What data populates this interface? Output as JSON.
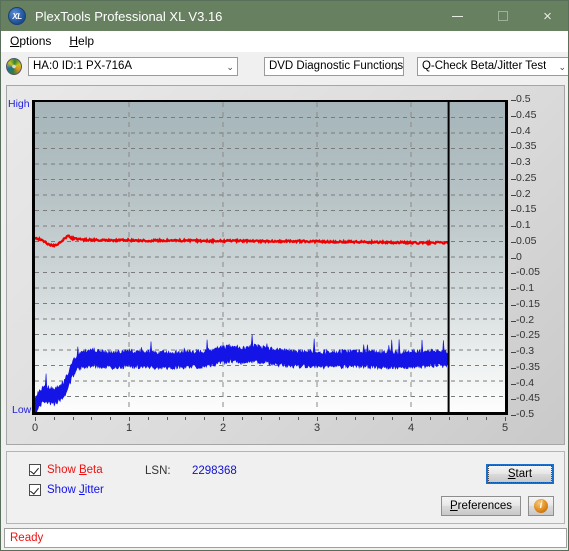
{
  "window": {
    "title": "PlexTools Professional XL V3.16",
    "icon": "XL",
    "minimize_label": "—",
    "maximize_label": "□",
    "close_label": "×",
    "titlebar_color": "#67805f"
  },
  "menu": {
    "items": [
      {
        "label": "Options",
        "accel": "O"
      },
      {
        "label": "Help",
        "accel": "H"
      }
    ]
  },
  "toolbar": {
    "drive_select": {
      "value": "HA:0 ID:1  PX-716A",
      "arrow": "⌄"
    },
    "function_select": {
      "value": "DVD Diagnostic Functions",
      "arrow": "⌄"
    },
    "test_select": {
      "value": "Q-Check Beta/Jitter Test",
      "arrow": "⌄"
    }
  },
  "chart_data": {
    "type": "line",
    "title": "",
    "xlabel": "",
    "ylabel": "",
    "xlim": [
      0,
      5
    ],
    "ylim": [
      -0.5,
      0.5
    ],
    "xticks": [
      0,
      1,
      2,
      3,
      4,
      5
    ],
    "xtick_labels": [
      "0",
      "1",
      "2",
      "3",
      "4",
      "5"
    ],
    "yticks": [
      0.5,
      0.45,
      0.4,
      0.35,
      0.3,
      0.25,
      0.2,
      0.15,
      0.1,
      0.05,
      0,
      -0.05,
      -0.1,
      -0.15,
      -0.2,
      -0.25,
      -0.3,
      -0.35,
      -0.4,
      -0.45,
      -0.5
    ],
    "ytick_labels": [
      "0.5",
      "0.45",
      "0.4",
      "0.35",
      "0.3",
      "0.25",
      "0.2",
      "0.15",
      "0.1",
      "0.05",
      "0",
      "-0.05",
      "-0.1",
      "-0.15",
      "-0.2",
      "-0.25",
      "-0.3",
      "-0.35",
      "-0.4",
      "-0.45",
      "-0.5"
    ],
    "axis_high_label": "High",
    "axis_low_label": "Low",
    "grid": true,
    "grid_style": "dashed",
    "data_end_x": 4.4,
    "marker_line_x": 4.4,
    "series": [
      {
        "name": "Beta",
        "color": "#ee0000",
        "x": [
          0.0,
          0.05,
          0.1,
          0.15,
          0.2,
          0.25,
          0.3,
          0.35,
          0.4,
          0.5,
          0.6,
          0.7,
          0.8,
          0.9,
          1.0,
          1.2,
          1.4,
          1.6,
          1.8,
          2.0,
          2.2,
          2.4,
          2.6,
          2.8,
          3.0,
          3.2,
          3.4,
          3.6,
          3.8,
          4.0,
          4.1,
          4.2,
          4.3,
          4.4
        ],
        "values": [
          0.06,
          0.058,
          0.05,
          0.04,
          0.036,
          0.042,
          0.056,
          0.068,
          0.06,
          0.056,
          0.055,
          0.055,
          0.054,
          0.054,
          0.054,
          0.053,
          0.053,
          0.053,
          0.052,
          0.052,
          0.052,
          0.051,
          0.051,
          0.051,
          0.05,
          0.049,
          0.049,
          0.048,
          0.047,
          0.046,
          0.045,
          0.046,
          0.046,
          0.046
        ],
        "noise": 0.006
      },
      {
        "name": "Jitter",
        "color": "#1414e6",
        "x": [
          0.0,
          0.05,
          0.1,
          0.15,
          0.2,
          0.25,
          0.3,
          0.35,
          0.4,
          0.45,
          0.5,
          0.6,
          0.7,
          0.8,
          0.9,
          1.0,
          1.2,
          1.4,
          1.6,
          1.8,
          2.0,
          2.1,
          2.2,
          2.3,
          2.4,
          2.5,
          2.6,
          2.8,
          3.0,
          3.2,
          3.4,
          3.6,
          3.8,
          4.0,
          4.2,
          4.3,
          4.4
        ],
        "values": [
          -0.48,
          -0.455,
          -0.44,
          -0.445,
          -0.45,
          -0.44,
          -0.43,
          -0.4,
          -0.36,
          -0.34,
          -0.33,
          -0.325,
          -0.33,
          -0.332,
          -0.33,
          -0.328,
          -0.33,
          -0.333,
          -0.33,
          -0.33,
          -0.315,
          -0.312,
          -0.318,
          -0.31,
          -0.315,
          -0.32,
          -0.325,
          -0.328,
          -0.33,
          -0.33,
          -0.328,
          -0.33,
          -0.332,
          -0.33,
          -0.328,
          -0.325,
          -0.33
        ],
        "band": 0.03,
        "noise": 0.03
      }
    ]
  },
  "controls": {
    "show_beta": {
      "label": "Show Beta",
      "accel": "B",
      "checked": true,
      "color": "#ee1111"
    },
    "show_jitter": {
      "label": "Show Jitter",
      "accel": "J",
      "checked": true,
      "color": "#1111ee"
    },
    "lsn_label": "LSN:",
    "lsn_value": "2298368",
    "start_button": {
      "label": "Start",
      "accel": "S",
      "focused": true
    },
    "preferences_button": {
      "label": "Preferences",
      "accel": "P"
    },
    "info_button": {
      "label": "i"
    }
  },
  "status": {
    "text": "Ready",
    "color": "#ee1111"
  }
}
